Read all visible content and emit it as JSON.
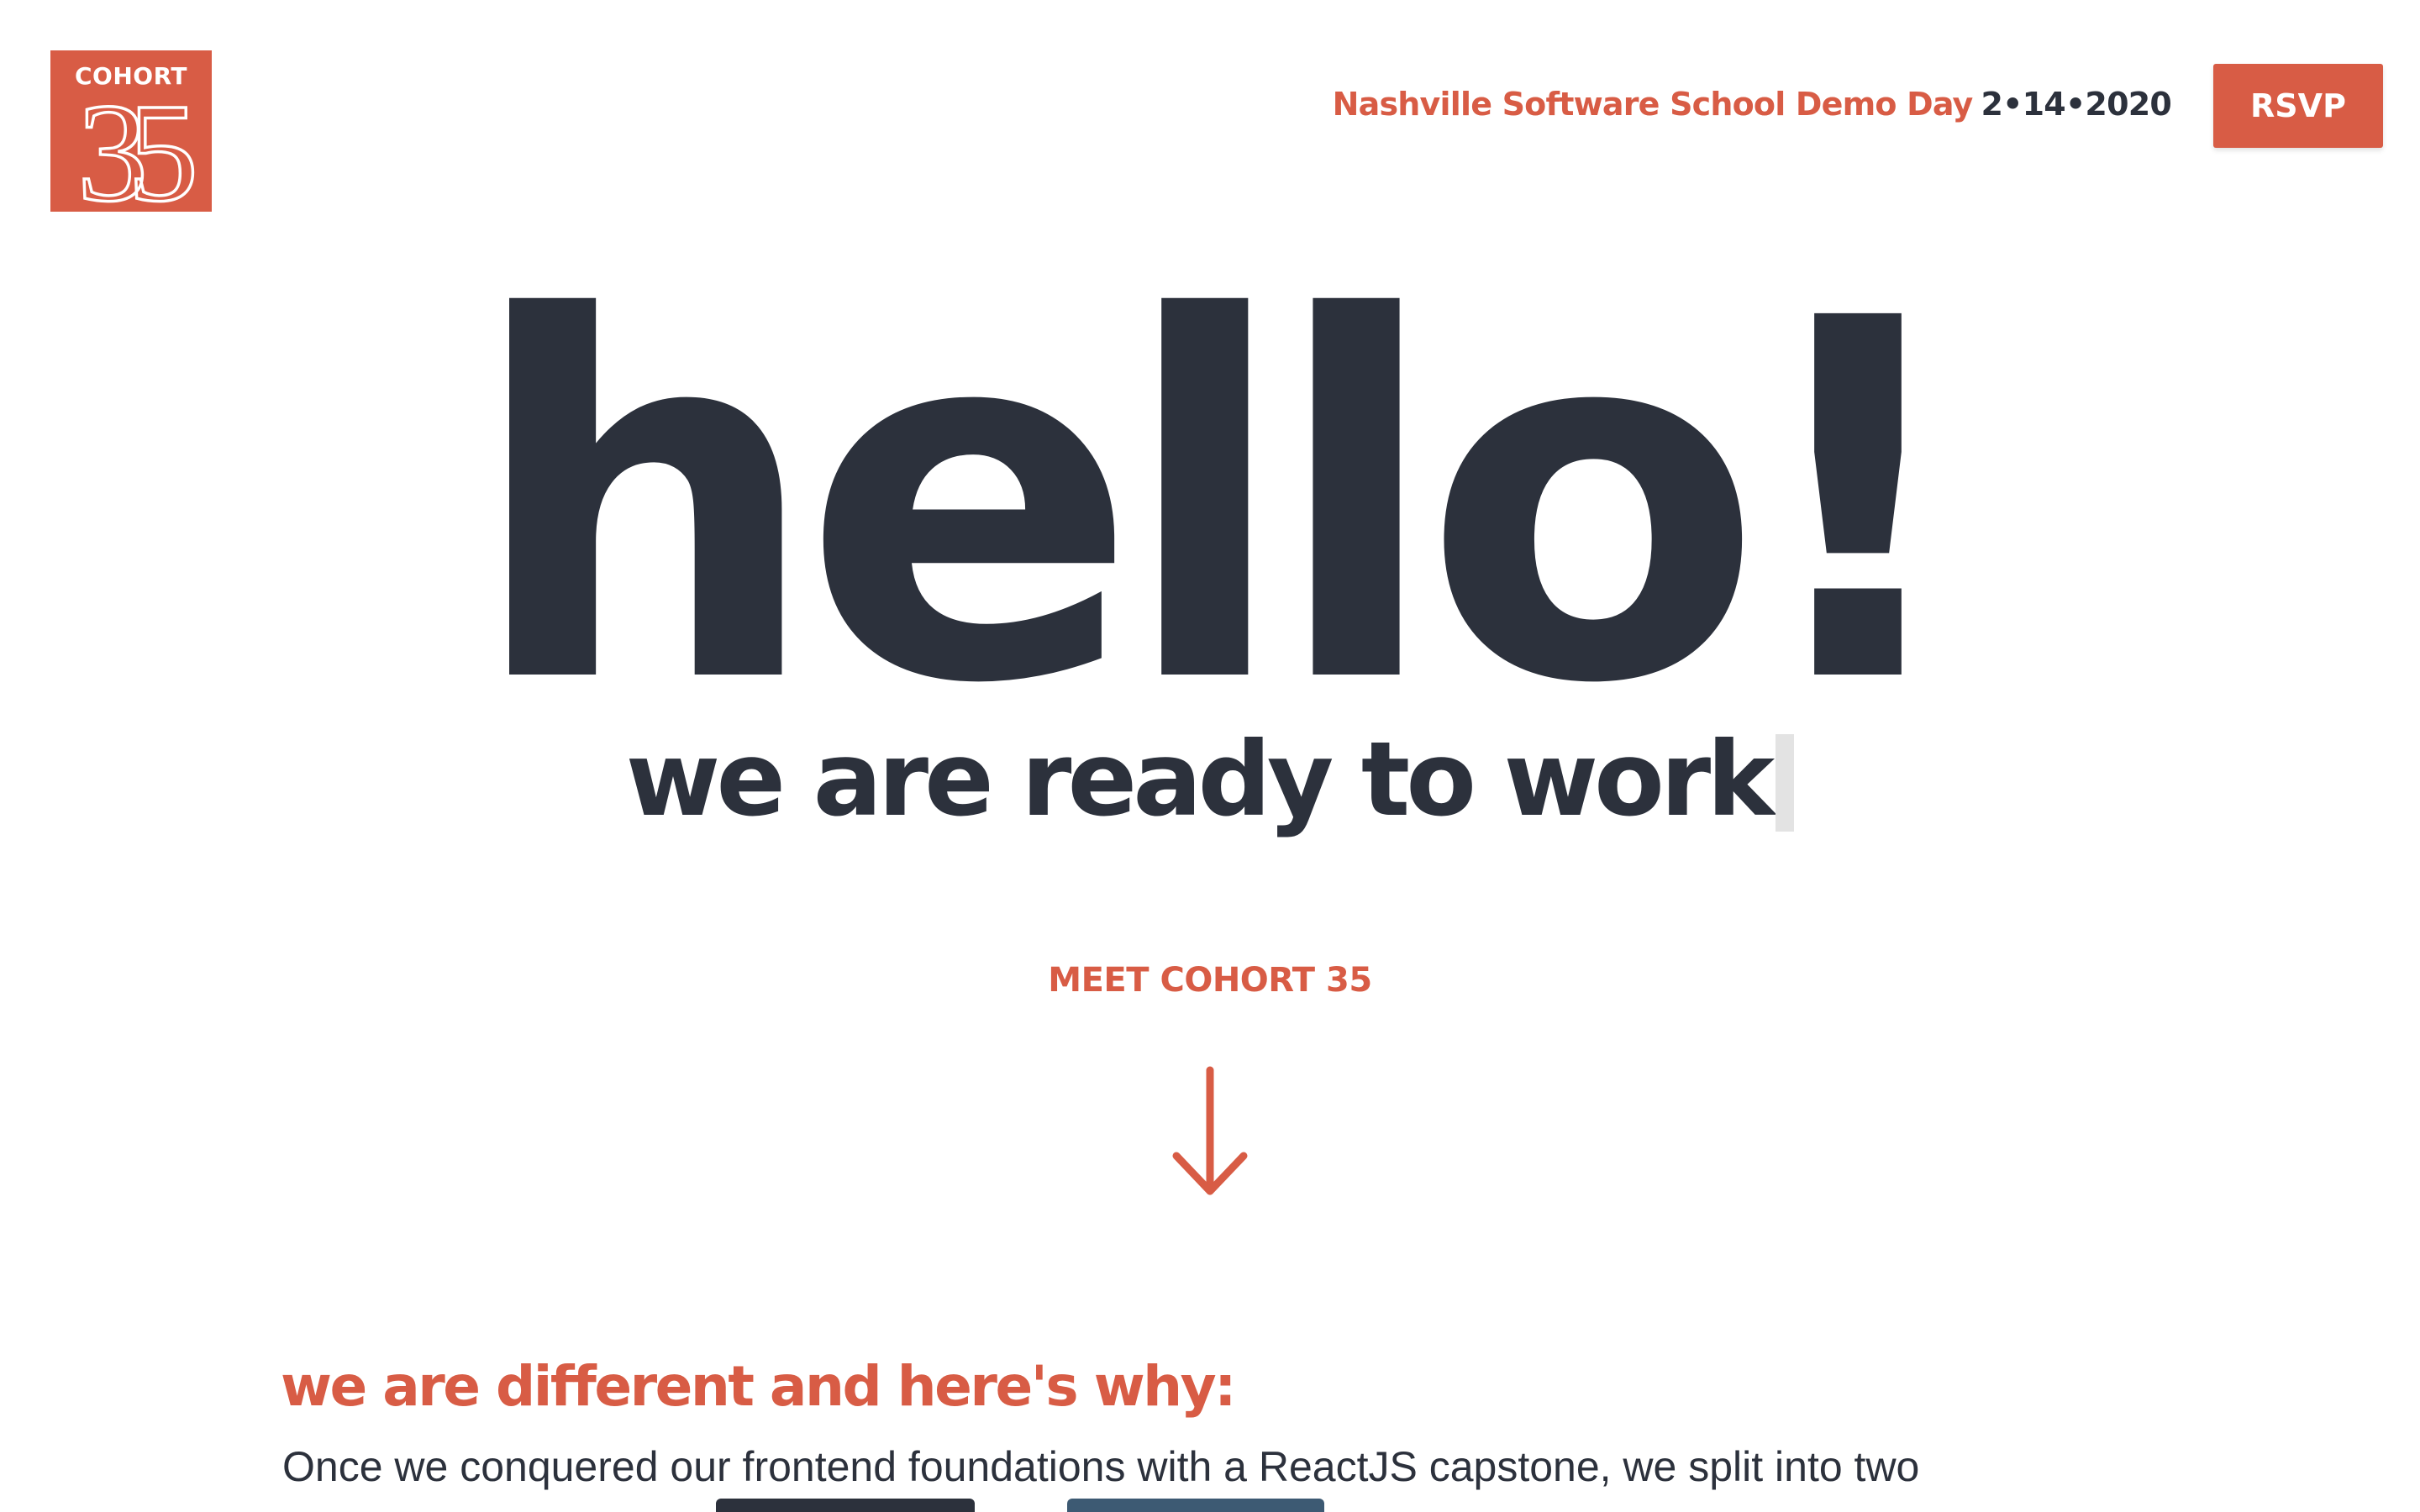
{
  "logo": {
    "label": "COHORT",
    "numeral": "35",
    "background_color": "#d85c45"
  },
  "header": {
    "event_name": "Nashville Software School Demo Day",
    "event_date": "2•14•2020",
    "rsvp_label": "RSVP"
  },
  "hero": {
    "title": "hello!",
    "subtitle": "we are ready to work",
    "meet_link": "MEET COHORT 35",
    "arrow_icon": "arrow-down-icon"
  },
  "about": {
    "heading": "we are different and here's why:",
    "body": "Once we conquered our  frontend foundations  with a ReactJS capstone, we split into two"
  },
  "colors": {
    "accent": "#d85c45",
    "text_dark": "#2c313c",
    "tab_dark": "#2c313c",
    "tab_blue": "#3d5a73",
    "background": "#ffffff"
  }
}
